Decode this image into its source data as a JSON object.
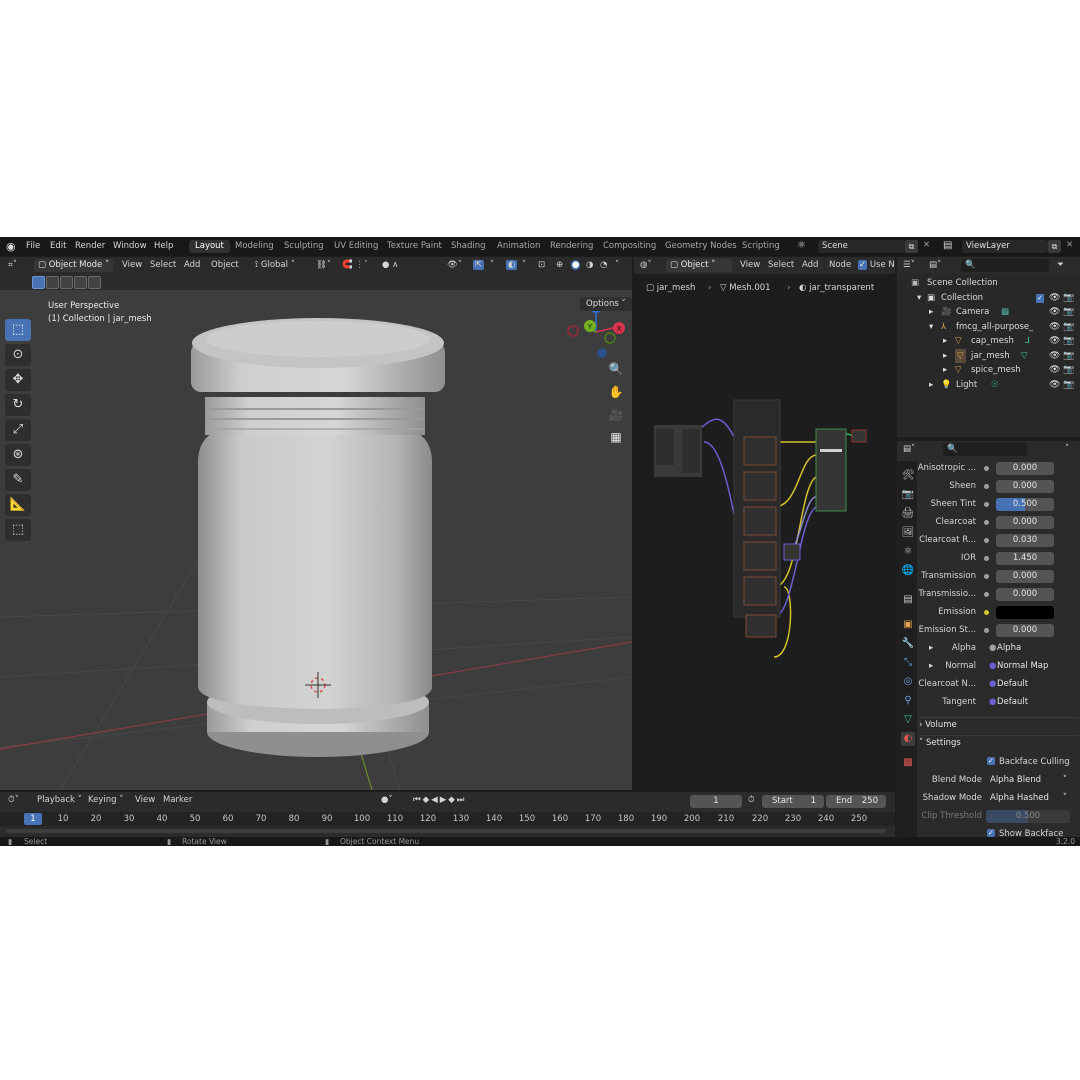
{
  "menu": {
    "items": [
      "File",
      "Edit",
      "Render",
      "Window",
      "Help"
    ],
    "workspaces": [
      "Layout",
      "Modeling",
      "Sculpting",
      "UV Editing",
      "Texture Paint",
      "Shading",
      "Animation",
      "Rendering",
      "Compositing",
      "Geometry Nodes",
      "Scripting"
    ],
    "active_workspace": "Layout",
    "scene": "Scene",
    "view_layer": "ViewLayer"
  },
  "viewport": {
    "mode": "Object Mode",
    "menus": [
      "View",
      "Select",
      "Add",
      "Object"
    ],
    "transform": "Global",
    "options": "Options",
    "perspective": "User Perspective",
    "collection_info": "(1) Collection | jar_mesh"
  },
  "node_editor": {
    "object_mode": "Object",
    "menus": [
      "View",
      "Select",
      "Add",
      "Node"
    ],
    "use_nodes": "Use No",
    "breadcrumb": [
      "jar_mesh",
      "Mesh.001",
      "jar_transparent"
    ]
  },
  "outliner": {
    "scene_collection": "Scene Collection",
    "collection": "Collection",
    "items": [
      "Camera",
      "fmcg_all-purpose_se",
      "cap_mesh",
      "jar_mesh",
      "spice_mesh",
      "Light"
    ]
  },
  "properties": {
    "rows": [
      {
        "label": "Anisotropic ...",
        "value": "0.000"
      },
      {
        "label": "Sheen",
        "value": "0.000"
      },
      {
        "label": "Sheen Tint",
        "value": "0.500"
      },
      {
        "label": "Clearcoat",
        "value": "0.000"
      },
      {
        "label": "Clearcoat R...",
        "value": "0.030"
      },
      {
        "label": "IOR",
        "value": "1.450"
      },
      {
        "label": "Transmission",
        "value": "0.000"
      },
      {
        "label": "Transmissio...",
        "value": "0.000"
      },
      {
        "label": "Emission",
        "value": ""
      },
      {
        "label": "Emission St...",
        "value": "0.000"
      }
    ],
    "links": [
      {
        "label": "Alpha",
        "value": "Alpha"
      },
      {
        "label": "Normal",
        "value": "Normal Map"
      },
      {
        "label": "Clearcoat N...",
        "value": "Default"
      },
      {
        "label": "Tangent",
        "value": "Default"
      }
    ],
    "volume": "Volume",
    "settings": "Settings",
    "backface_culling": "Backface Culling",
    "blend_mode_label": "Blend Mode",
    "blend_mode": "Alpha Blend",
    "shadow_mode_label": "Shadow Mode",
    "shadow_mode": "Alpha Hashed",
    "clip_threshold_label": "Clip Threshold",
    "clip_threshold": "0.500",
    "show_backface": "Show Backface"
  },
  "timeline": {
    "menus": [
      "Playback",
      "Keying",
      "View",
      "Marker"
    ],
    "current_frame": "1",
    "start_label": "Start",
    "start": "1",
    "end_label": "End",
    "end": "250",
    "ticks": [
      "10",
      "20",
      "30",
      "40",
      "50",
      "60",
      "70",
      "80",
      "90",
      "100",
      "110",
      "120",
      "130",
      "140",
      "150",
      "160",
      "170",
      "180",
      "190",
      "200",
      "210",
      "220",
      "230",
      "240",
      "250"
    ]
  },
  "status": {
    "select": "Select",
    "rotate": "Rotate View",
    "context": "Object Context Menu",
    "version": "3.2.0"
  },
  "colors": {
    "accent": "#4772b3",
    "viewport_bg": "#3d3d3d",
    "node_bg": "#1d1d1d",
    "x_axis": "#ff3352",
    "y_axis": "#8bdc00",
    "z_axis": "#2890ff"
  }
}
